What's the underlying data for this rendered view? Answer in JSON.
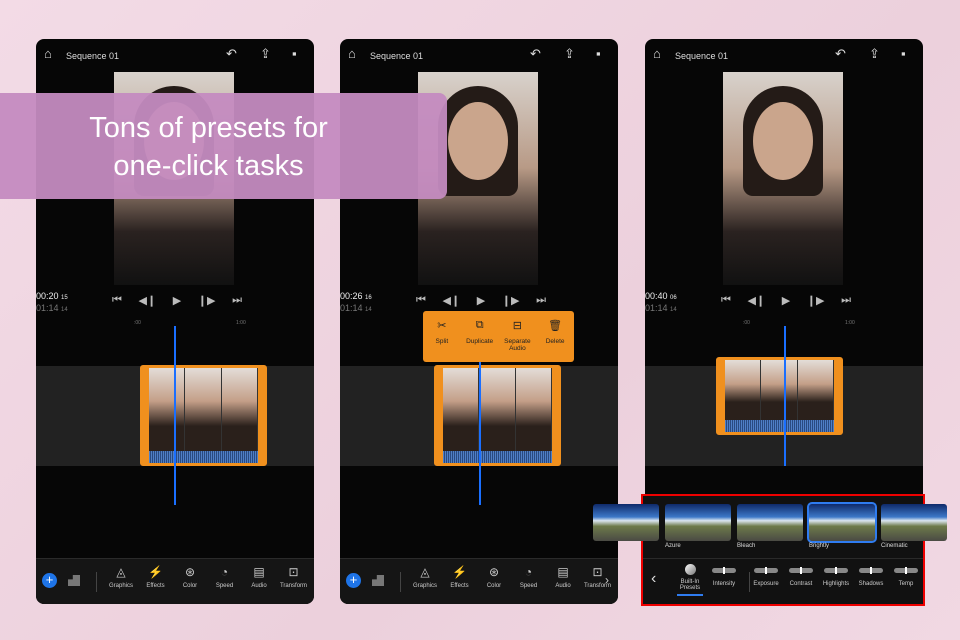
{
  "banner": {
    "line1": "Tons of presets for",
    "line2": "one-click tasks"
  },
  "header": {
    "title": "Sequence 01"
  },
  "ruler": {
    "start": ":00",
    "end": "1:00"
  },
  "panels": [
    {
      "current": "00:20",
      "current_frames": "15",
      "total": "01:14",
      "total_frames": "14"
    },
    {
      "current": "00:26",
      "current_frames": "16",
      "total": "01:14",
      "total_frames": "14"
    },
    {
      "current": "00:40",
      "current_frames": "06",
      "total": "01:14",
      "total_frames": "14"
    }
  ],
  "toolbar": [
    {
      "label": "Graphics"
    },
    {
      "label": "Effects"
    },
    {
      "label": "Color"
    },
    {
      "label": "Speed"
    },
    {
      "label": "Audio"
    },
    {
      "label": "Transform"
    }
  ],
  "context_menu": [
    {
      "label": "Split",
      "icon": "✂"
    },
    {
      "label": "Duplicate",
      "icon": "⧉"
    },
    {
      "label": "Separate Audio",
      "icon": "⊟"
    },
    {
      "label": "Delete",
      "icon": "🗑"
    }
  ],
  "presets": {
    "items": [
      {
        "label": "Azure"
      },
      {
        "label": "Bleach"
      },
      {
        "label": "Brightly",
        "selected": true
      },
      {
        "label": "Cinematic"
      }
    ],
    "adjustments": [
      {
        "label": "Built-In Presets",
        "active": true
      },
      {
        "label": "Intensity"
      },
      {
        "label": "Exposure"
      },
      {
        "label": "Contrast"
      },
      {
        "label": "Highlights"
      },
      {
        "label": "Shadows"
      },
      {
        "label": "Temp"
      }
    ]
  },
  "colors": {
    "accent": "#1e74e8",
    "clip": "#f0901e",
    "banner": "#c48bc0",
    "highlight": "#ee0000"
  }
}
